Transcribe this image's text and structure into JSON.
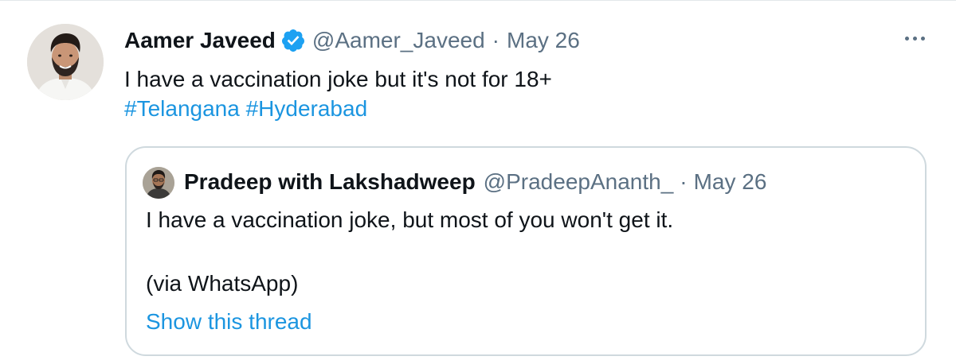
{
  "tweet": {
    "author_name": "Aamer Javeed",
    "handle": "@Aamer_Javeed",
    "separator": "·",
    "date": "May 26",
    "text": "I have a vaccination joke but it's not for 18+",
    "hashtags": [
      "#Telangana",
      "#Hyderabad"
    ],
    "verified_icon": "verified-badge-icon",
    "more_icon": "more-options-icon"
  },
  "quoted_tweet": {
    "author_name": "Pradeep with Lakshadweep",
    "handle": "@PradeepAnanth_",
    "separator": "·",
    "date": "May 26",
    "text_line1": "I have a vaccination joke, but most of you won't get it.",
    "text_line2": "(via WhatsApp)",
    "show_thread_label": "Show this thread"
  },
  "colors": {
    "link": "#1b95e0",
    "muted": "#5b7083",
    "text": "#0f1419",
    "border": "#cfd9de",
    "verified": "#1da1f2"
  }
}
